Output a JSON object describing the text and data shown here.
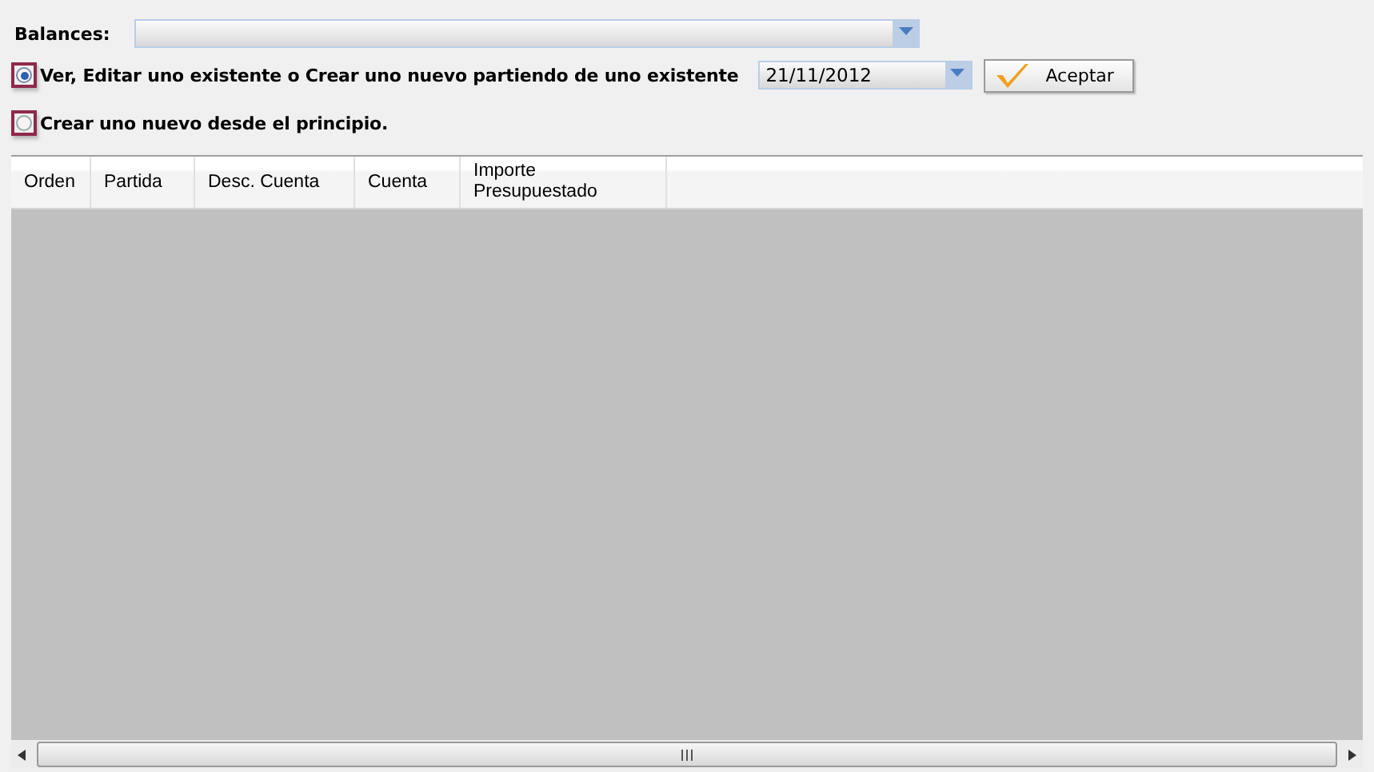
{
  "balances": {
    "label": "Balances:"
  },
  "options": [
    {
      "label": "Ver, Editar uno existente o Crear uno nuevo partiendo de uno existente",
      "selected": true
    },
    {
      "label": "Crear uno nuevo desde el principio.",
      "selected": false
    }
  ],
  "date": {
    "value": "21/11/2012"
  },
  "accept_button": {
    "label": "Aceptar"
  },
  "table": {
    "columns": [
      {
        "label": "Orden"
      },
      {
        "label": "Partida"
      },
      {
        "label": "Desc. Cuenta"
      },
      {
        "label": "Cuenta"
      },
      {
        "label": "Importe Presupuestado"
      }
    ]
  }
}
